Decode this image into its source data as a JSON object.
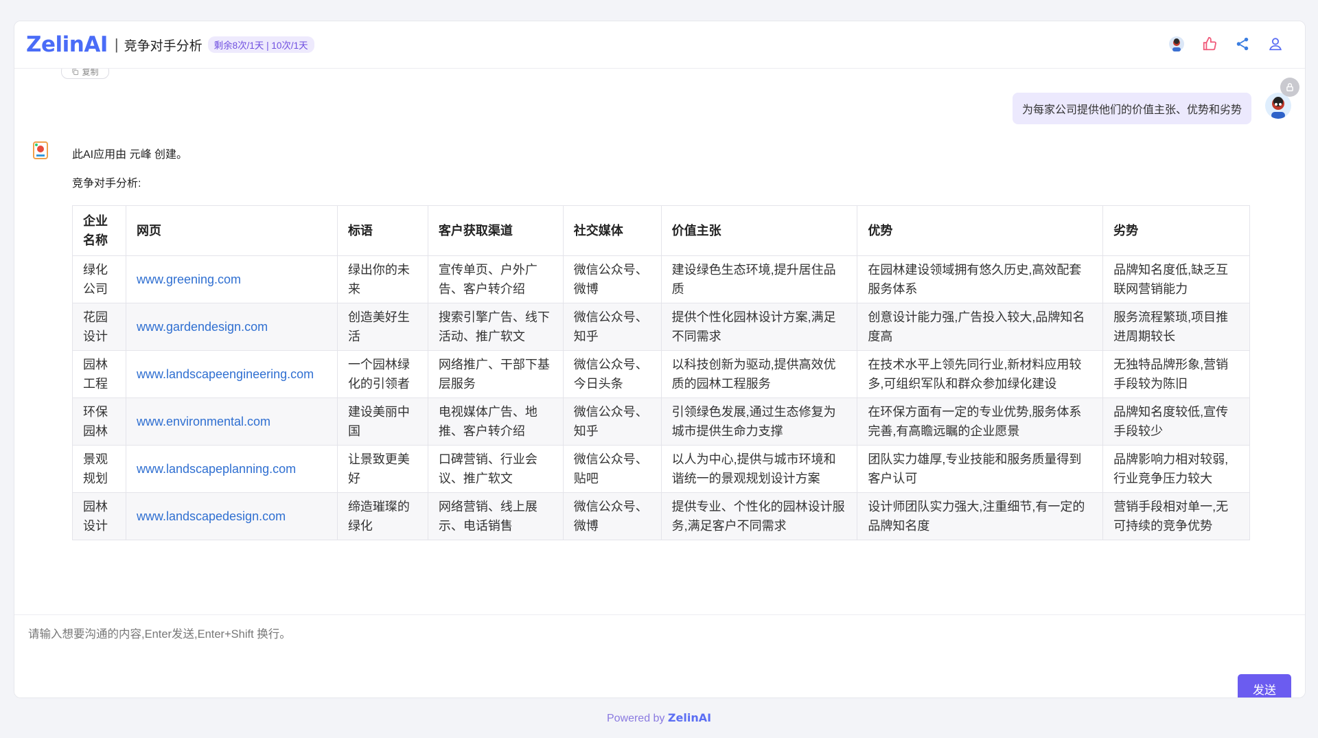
{
  "app": {
    "logo": "ZelinAI",
    "separator": "|",
    "title": "竞争对手分析",
    "quota": "剩余8次/1天 | 10次/1天"
  },
  "chat": {
    "copy_label": "复制",
    "user_message": "为每家公司提供他们的价值主张、优势和劣势",
    "bot_intro": "此AI应用由 元峰 创建。",
    "bot_heading": "竞争对手分析:"
  },
  "table": {
    "headers": [
      "企业名称",
      "网页",
      "标语",
      "客户获取渠道",
      "社交媒体",
      "价值主张",
      "优势",
      "劣势"
    ],
    "rows": [
      [
        "绿化公司",
        "www.greening.com",
        "绿出你的未来",
        "宣传单页、户外广告、客户转介绍",
        "微信公众号、微博",
        "建设绿色生态环境,提升居住品质",
        "在园林建设领域拥有悠久历史,高效配套服务体系",
        "品牌知名度低,缺乏互联网营销能力"
      ],
      [
        "花园设计",
        "www.gardendesign.com",
        "创造美好生活",
        "搜索引擎广告、线下活动、推广软文",
        "微信公众号、知乎",
        "提供个性化园林设计方案,满足不同需求",
        "创意设计能力强,广告投入较大,品牌知名度高",
        "服务流程繁琐,项目推进周期较长"
      ],
      [
        "园林工程",
        "www.landscapeengineering.com",
        "一个园林绿化的引领者",
        "网络推广、干部下基层服务",
        "微信公众号、今日头条",
        "以科技创新为驱动,提供高效优质的园林工程服务",
        "在技术水平上领先同行业,新材料应用较多,可组织军队和群众参加绿化建设",
        "无独特品牌形象,营销手段较为陈旧"
      ],
      [
        "环保园林",
        "www.environmental.com",
        "建设美丽中国",
        "电视媒体广告、地推、客户转介绍",
        "微信公众号、知乎",
        "引领绿色发展,通过生态修复为城市提供生命力支撑",
        "在环保方面有一定的专业优势,服务体系完善,有高瞻远瞩的企业愿景",
        "品牌知名度较低,宣传手段较少"
      ],
      [
        "景观规划",
        "www.landscapeplanning.com",
        "让景致更美好",
        "口碑营销、行业会议、推广软文",
        "微信公众号、贴吧",
        "以人为中心,提供与城市环境和谐统一的景观规划设计方案",
        "团队实力雄厚,专业技能和服务质量得到客户认可",
        "品牌影响力相对较弱,行业竞争压力较大"
      ],
      [
        "园林设计",
        "www.landscapedesign.com",
        "缔造璀璨的绿化",
        "网络营销、线上展示、电话销售",
        "微信公众号、微博",
        "提供专业、个性化的园林设计服务,满足客户不同需求",
        "设计师团队实力强大,注重细节,有一定的品牌知名度",
        "营销手段相对单一,无可持续的竞争优势"
      ]
    ]
  },
  "input": {
    "placeholder": "请输入想要沟通的内容,Enter发送,Enter+Shift 换行。",
    "send_label": "发送"
  },
  "footer": {
    "powered_by": "Powered by",
    "brand": "ZelinAI"
  },
  "colors": {
    "accent": "#6b5cf0",
    "link": "#2f6fd1",
    "user_bubble": "#ece9fd"
  }
}
